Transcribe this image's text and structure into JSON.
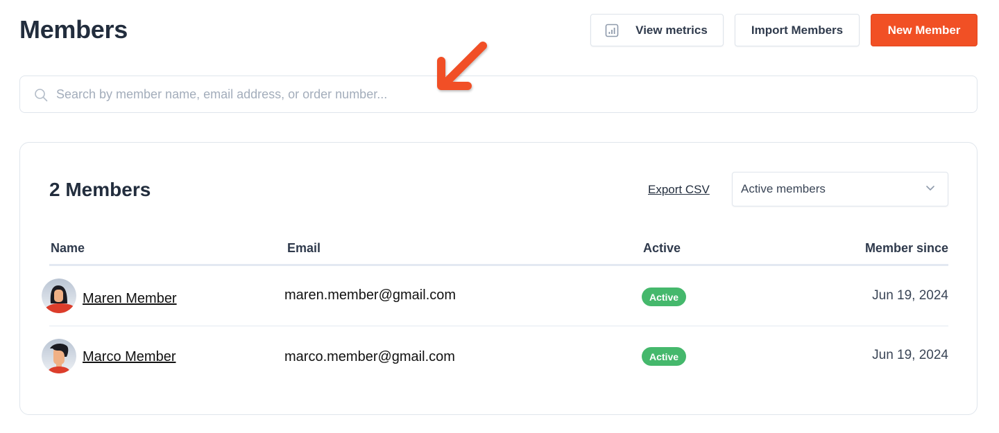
{
  "header": {
    "title": "Members",
    "buttons": {
      "view_metrics": "View metrics",
      "import_members": "Import Members",
      "new_member": "New Member"
    }
  },
  "search": {
    "placeholder": "Search by member name, email address, or order number...",
    "value": ""
  },
  "card": {
    "title": "2 Members",
    "export_label": "Export CSV",
    "filter": {
      "selected": "Active members"
    },
    "table": {
      "columns": [
        "Name",
        "Email",
        "Active",
        "Member since"
      ],
      "rows": [
        {
          "name": "Maren Member",
          "email": "maren.member@gmail.com",
          "status": "Active",
          "since": "Jun 19, 2024",
          "avatar": "female-avatar"
        },
        {
          "name": "Marco Member",
          "email": "marco.member@gmail.com",
          "status": "Active",
          "since": "Jun 19, 2024",
          "avatar": "male-avatar"
        }
      ]
    }
  },
  "colors": {
    "accent": "#f15025",
    "status_active": "#45b86c",
    "text_dark": "#222d3d",
    "border": "#dfe5ec"
  }
}
